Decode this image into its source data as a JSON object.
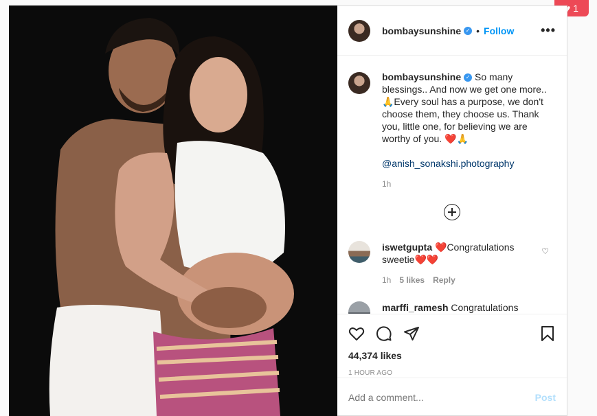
{
  "notification": {
    "count": "1",
    "icon": "heart-icon"
  },
  "post": {
    "username": "bombaysunshine",
    "follow_label": "Follow",
    "dot": "•",
    "more": "•••",
    "caption": {
      "username": "bombaysunshine",
      "text": "So many blessings.. And now we get one more.. 🙏Every soul has a purpose, we don't choose them, they choose us. Thank you, little one, for believing we are worthy of you. ❤️🙏",
      "mention": "@anish_sonakshi.photography",
      "time": "1h"
    },
    "comments": [
      {
        "username": "iswetgupta",
        "text": "❤️Congratulations sweetie❤️❤️",
        "time": "1h",
        "likes": "5 likes",
        "reply": "Reply"
      },
      {
        "username": "marffi_ramesh",
        "text": "Congratulations"
      }
    ],
    "likes": "44,374 likes",
    "ago": "1 HOUR AGO",
    "add_comment_placeholder": "Add a comment...",
    "post_label": "Post"
  },
  "colors": {
    "accent": "#0095f6",
    "notification": "#ed4956",
    "post_disabled": "#b2dffc"
  }
}
